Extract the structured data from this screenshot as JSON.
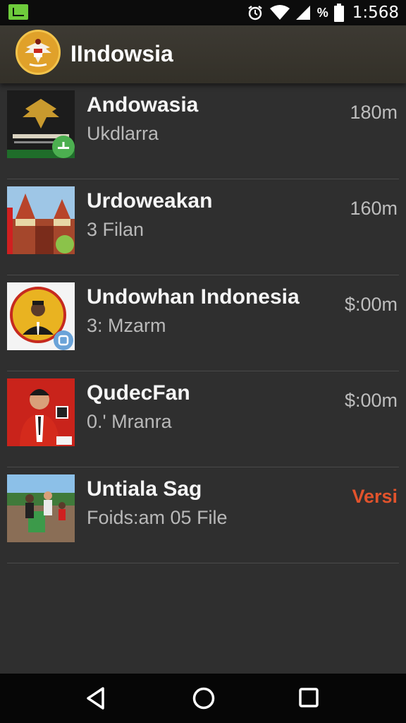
{
  "status_bar": {
    "time": "1:568",
    "battery_label": "%"
  },
  "app": {
    "title": "IIndowsia"
  },
  "items": [
    {
      "title": "Andowasia",
      "subtitle": "Ukdlarra",
      "meta": "180m"
    },
    {
      "title": "Urdoweakan",
      "subtitle": "3  Filan",
      "meta": "160m"
    },
    {
      "title": "Undowhan Indonesia",
      "subtitle": "3: Mzarm",
      "meta": "$:00m"
    },
    {
      "title": "QudecFan",
      "subtitle": "0.' Mranra",
      "meta": "$:00m"
    },
    {
      "title": "Untiala Sag",
      "subtitle": "Foids:am  05 File",
      "meta": "Versi"
    }
  ],
  "colors": {
    "background": "#2f2f2f",
    "accent": "#e2532c",
    "app_bar": "#3a372f"
  },
  "icons": {
    "back": "back-triangle-icon",
    "home": "home-circle-icon",
    "recents": "recents-square-icon"
  }
}
